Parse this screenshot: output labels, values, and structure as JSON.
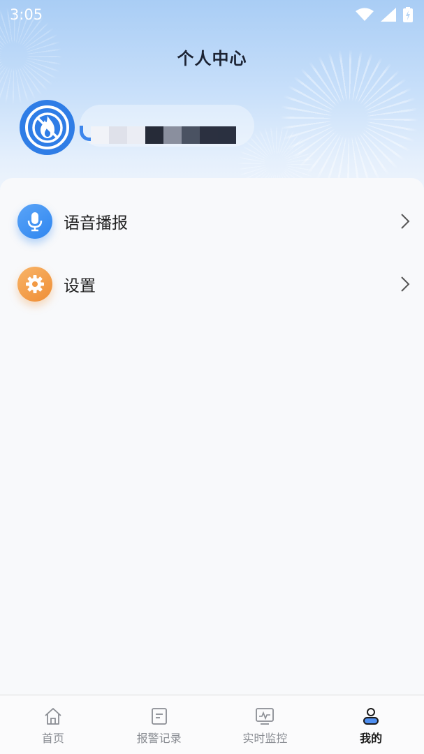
{
  "status_bar": {
    "time": "3:05"
  },
  "header": {
    "title": "个人中心"
  },
  "profile": {
    "avatar_icon": "fire-prohibited-icon",
    "username_obscured": true
  },
  "menu": [
    {
      "label": "语音播报",
      "icon": "microphone-icon",
      "color": "#2f86f0"
    },
    {
      "label": "设置",
      "icon": "gear-icon",
      "color": "#f0973f"
    }
  ],
  "tabbar": {
    "tabs": [
      {
        "label": "首页",
        "icon": "home-icon",
        "active": false
      },
      {
        "label": "报警记录",
        "icon": "document-icon",
        "active": false
      },
      {
        "label": "实时监控",
        "icon": "monitor-icon",
        "active": false
      },
      {
        "label": "我的",
        "icon": "user-icon",
        "active": true
      }
    ]
  },
  "colors": {
    "accent": "#2f7de6",
    "header_gradient_top": "#a9cdf5",
    "active_tab": "#1a1a1a",
    "inactive_tab": "#8a8d93"
  }
}
